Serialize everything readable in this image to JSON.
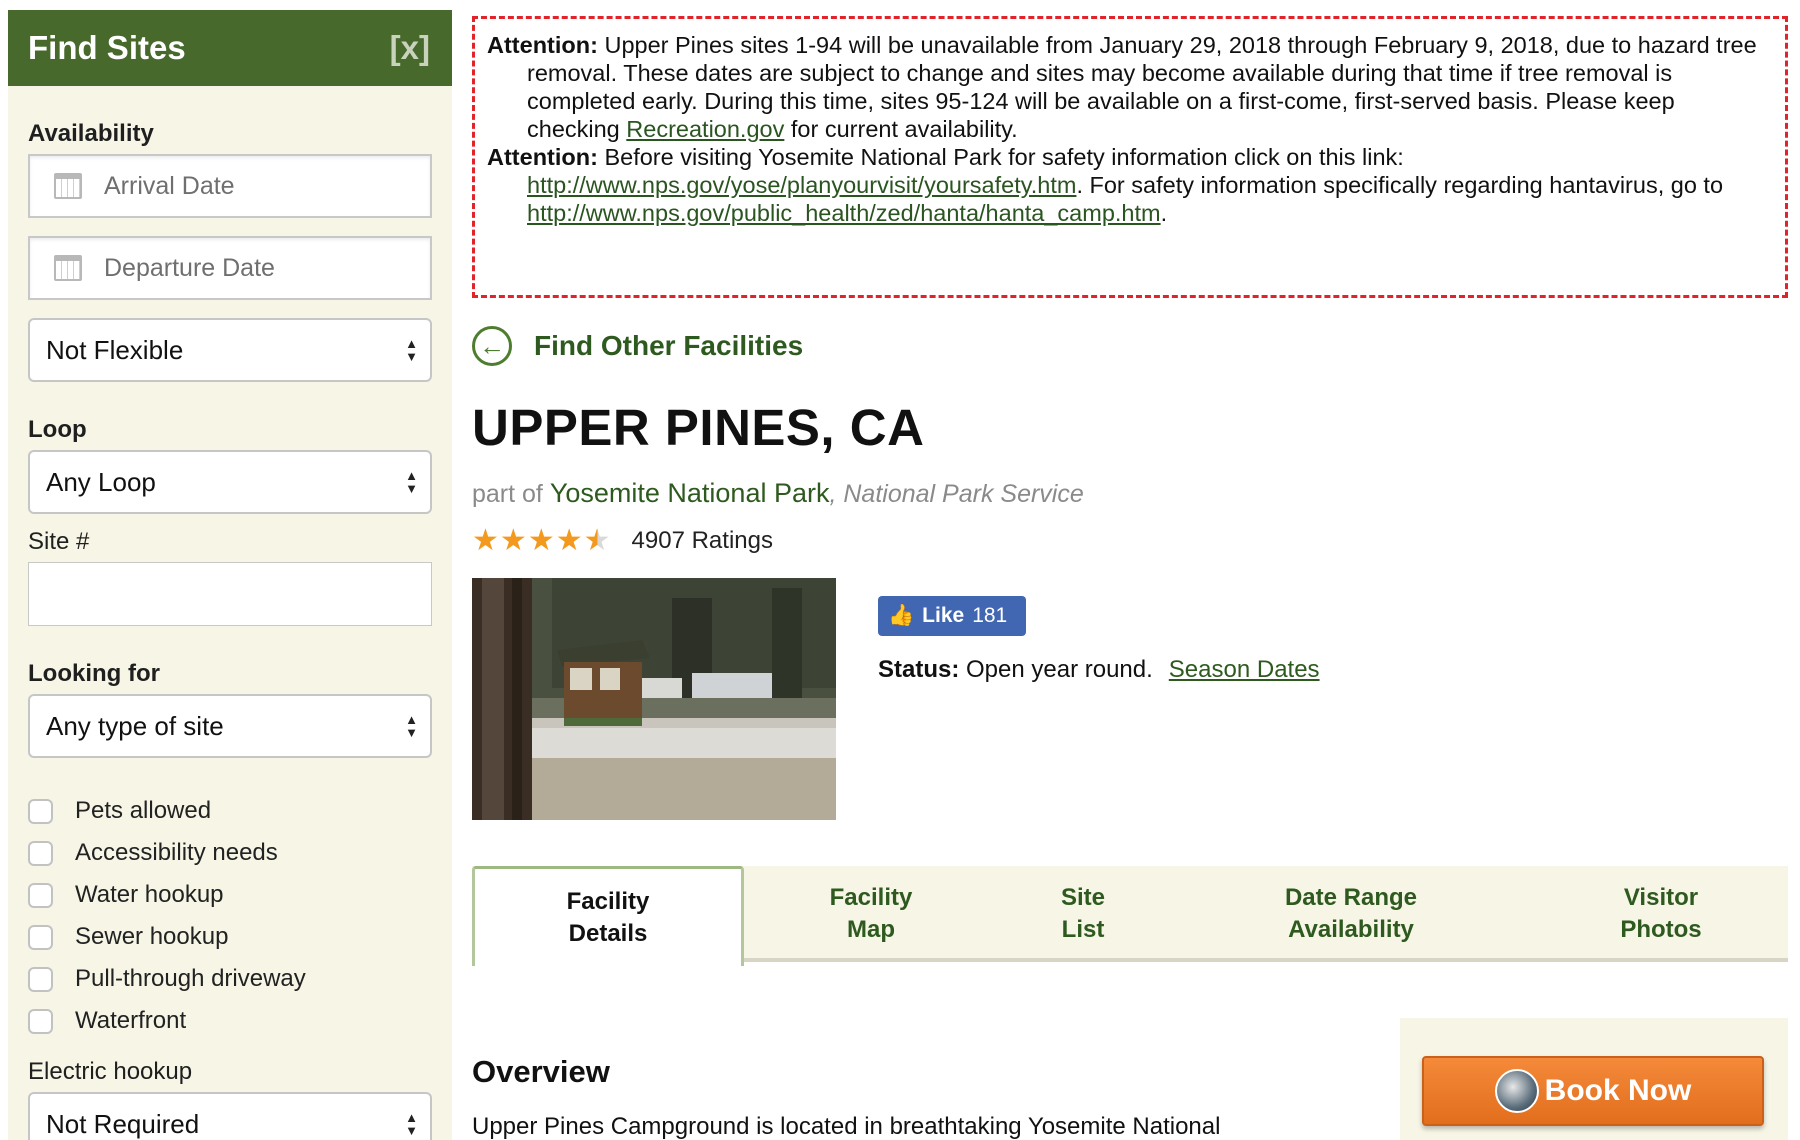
{
  "sidebar": {
    "title": "Find Sites",
    "close_label": "[x]",
    "availability_label": "Availability",
    "arrival_placeholder": "Arrival Date",
    "departure_placeholder": "Departure Date",
    "flexible_selected": "Not Flexible",
    "loop_label": "Loop",
    "loop_selected": "Any Loop",
    "site_label": "Site #",
    "site_value": "",
    "looking_for_label": "Looking for",
    "site_type_selected": "Any type of site",
    "checkboxes": [
      {
        "label": "Pets allowed",
        "checked": false
      },
      {
        "label": "Accessibility needs",
        "checked": false
      },
      {
        "label": "Water hookup",
        "checked": false
      },
      {
        "label": "Sewer hookup",
        "checked": false
      },
      {
        "label": "Pull-through driveway",
        "checked": false
      },
      {
        "label": "Waterfront",
        "checked": false
      }
    ],
    "electric_label": "Electric hookup",
    "electric_selected": "Not Required"
  },
  "alert": {
    "p1_bold": "Attention:",
    "p1_text": " Upper Pines sites 1-94 will be unavailable from January 29, 2018 through February 9, 2018, due to hazard tree removal. These dates are subject to change and sites may become available during that time if tree removal is completed early. During this time, sites 95-124 will be available on a first-come, first-served basis. Please keep checking ",
    "p1_link": "Recreation.gov",
    "p1_tail": " for current availability.",
    "p2_bold": "Attention:",
    "p2_text": " Before visiting Yosemite National Park for safety information click on this link: ",
    "p2_link1": "http://www.nps.gov/yose/planyourvisit/yoursafety.htm",
    "p2_mid": ". For safety information specifically regarding hantavirus, go to ",
    "p2_link2": "http://www.nps.gov/public_health/zed/hanta/hanta_camp.htm",
    "p2_tail": "."
  },
  "back_link": "Find Other Facilities",
  "facility": {
    "title": "UPPER PINES, CA",
    "part_of": "part of ",
    "park": "Yosemite National Park",
    "agency": ", National Park Service",
    "rating": 4.5,
    "ratings_count": "4907 Ratings",
    "like_label": "Like",
    "like_count": "181",
    "status_label": "Status:",
    "status_value": " Open year round.",
    "season_link": "Season Dates"
  },
  "tabs": [
    {
      "line1": "Facility",
      "line2": "Details",
      "active": true
    },
    {
      "line1": "Facility",
      "line2": "Map",
      "active": false
    },
    {
      "line1": "Site",
      "line2": "List",
      "active": false
    },
    {
      "line1": "Date Range",
      "line2": "Availability",
      "active": false
    },
    {
      "line1": "Visitor",
      "line2": "Photos",
      "active": false
    }
  ],
  "overview": {
    "title": "Overview",
    "text": "Upper Pines Campground is located in breathtaking Yosemite National Park in Central California's rugged Sierra Nevada Mountain Range at an"
  },
  "book_now": "Book Now",
  "colors": {
    "header_green": "#47692b",
    "link_green": "#2e5a1f",
    "alert_red": "#e2232a",
    "book_orange": "#f07a26",
    "sidebar_bg": "#f6f5e6"
  }
}
